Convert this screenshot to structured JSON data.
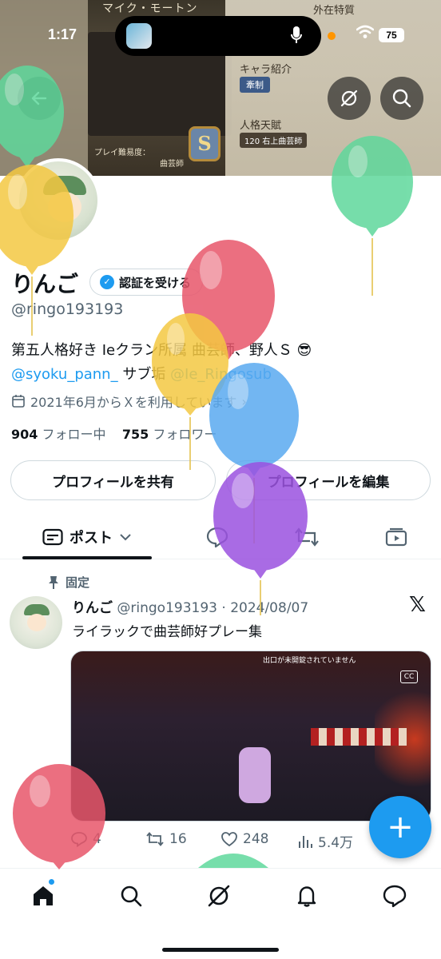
{
  "status_bar": {
    "time": "1:17",
    "battery": "75"
  },
  "banner": {
    "character_name": "マイク・モートン",
    "feature_label": "外在特質",
    "chara_intro_label": "キャラ紹介",
    "chara_tag": "牽制",
    "persona_label": "人格天賦",
    "persona_value": "120 右上曲芸師",
    "difficulty_label": "プレイ難易度：",
    "role_label": "曲芸師",
    "badge_letter": "S"
  },
  "profile": {
    "display_name": "りんご",
    "verify_button": "認証を受ける",
    "handle": "@ringo193193",
    "bio_line1": "第五人格好き Ieクラン所属 曲芸師、野人Ｓ 😎",
    "bio_mention1": "@syoku_pann_",
    "bio_sub": " サブ垢 ",
    "bio_mention2": "@Ie_Ringosub",
    "joined": "2021年6月からＸを利用しています",
    "following_count": "904",
    "following_label": "フォロー中",
    "followers_count": "755",
    "followers_label": "フォロワー",
    "share_button": "プロフィールを共有",
    "edit_button": "プロフィールを編集"
  },
  "tabs": {
    "posts_label": "ポスト"
  },
  "post": {
    "pinned_label": "固定",
    "author_name": "りんご",
    "meta": "@ringo193193 · 2024/08/07",
    "text": "ライラックで曲芸師好プレー集",
    "media_hud": "出口が未開錠されていません",
    "media_cc": "CC",
    "replies": "4",
    "reposts": "16",
    "likes": "248",
    "views": "5.4万"
  },
  "fab": {
    "label": "+"
  },
  "colors": {
    "accent": "#1d9bf0",
    "text_primary": "#0f1419",
    "text_secondary": "#536471",
    "balloon_green": "#5fd89c",
    "balloon_yellow": "#f4c842",
    "balloon_red": "#e8566b",
    "balloon_blue": "#5aaaf0",
    "balloon_purple": "#9b52e0"
  }
}
